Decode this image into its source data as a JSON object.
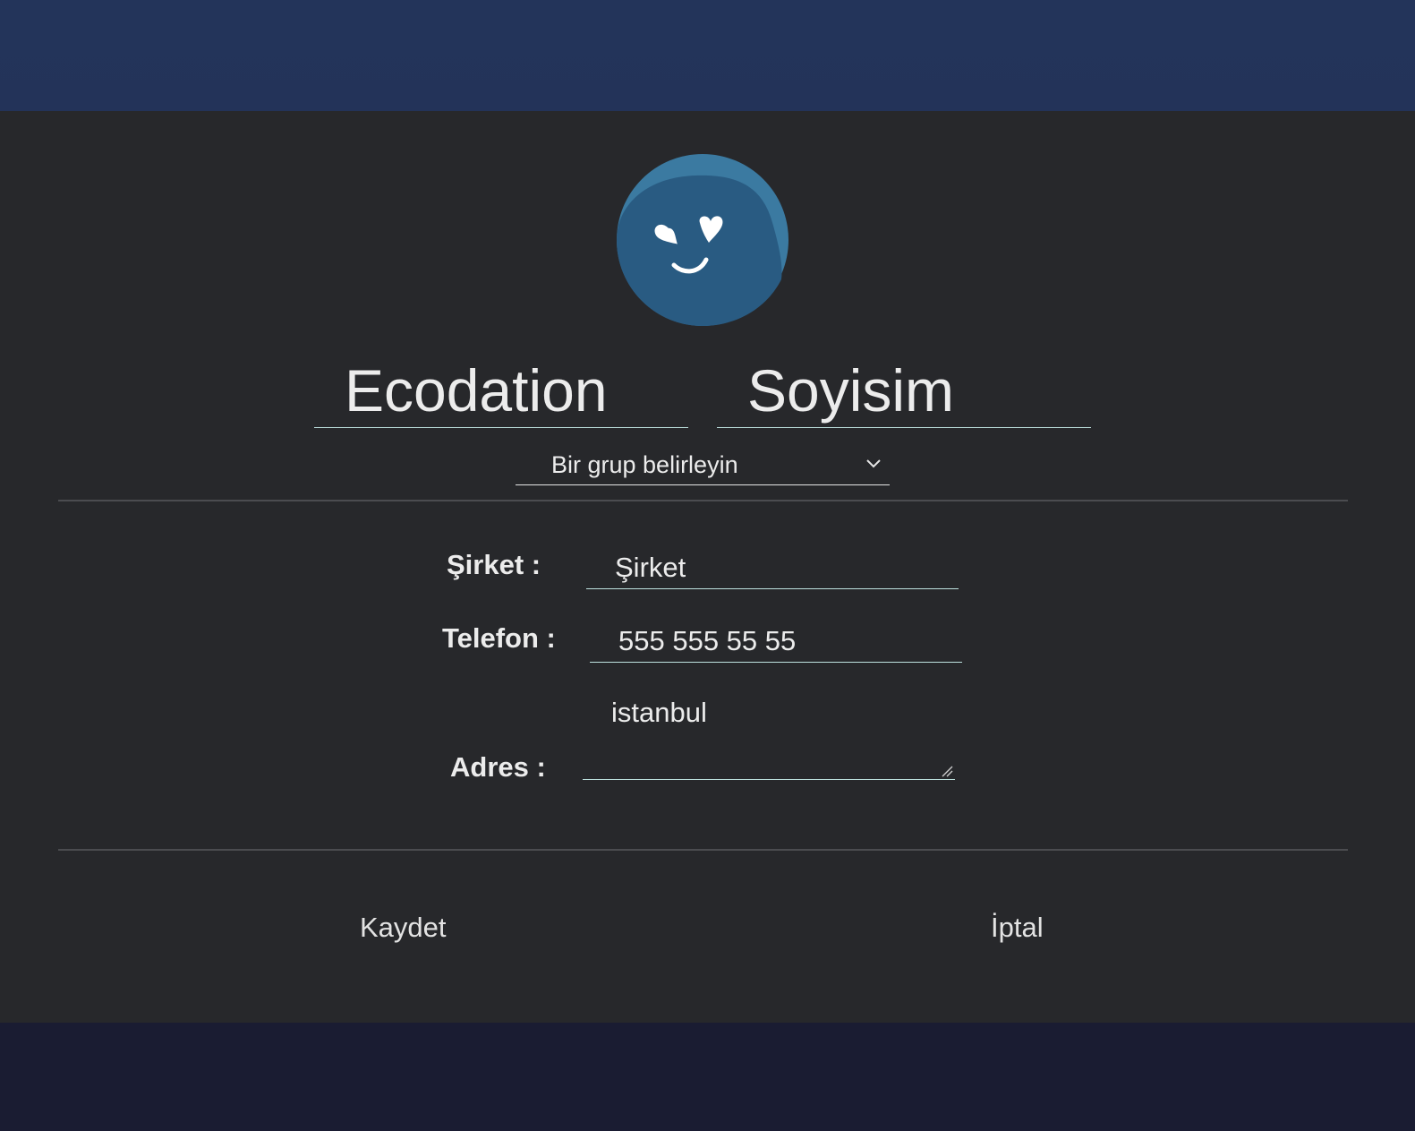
{
  "form": {
    "first_name": "Ecodation",
    "last_name": "Soyisim",
    "group_select": {
      "selected": "Bir grup belirleyin"
    },
    "company": {
      "label": "Şirket :",
      "value": "Şirket"
    },
    "phone": {
      "label": "Telefon :",
      "value": "555 555 55 55"
    },
    "address": {
      "label": "Adres :",
      "value": "istanbul"
    }
  },
  "actions": {
    "save_label": "Kaydet",
    "cancel_label": "İptal"
  },
  "avatar": {
    "icon": "heart-eyes-smiley-icon"
  },
  "colors": {
    "header": "#23345a",
    "panel": "#27282b",
    "footer": "#1a1c32",
    "avatar_fill": "#2a5b82",
    "input_underline": "#bfe3e0"
  }
}
